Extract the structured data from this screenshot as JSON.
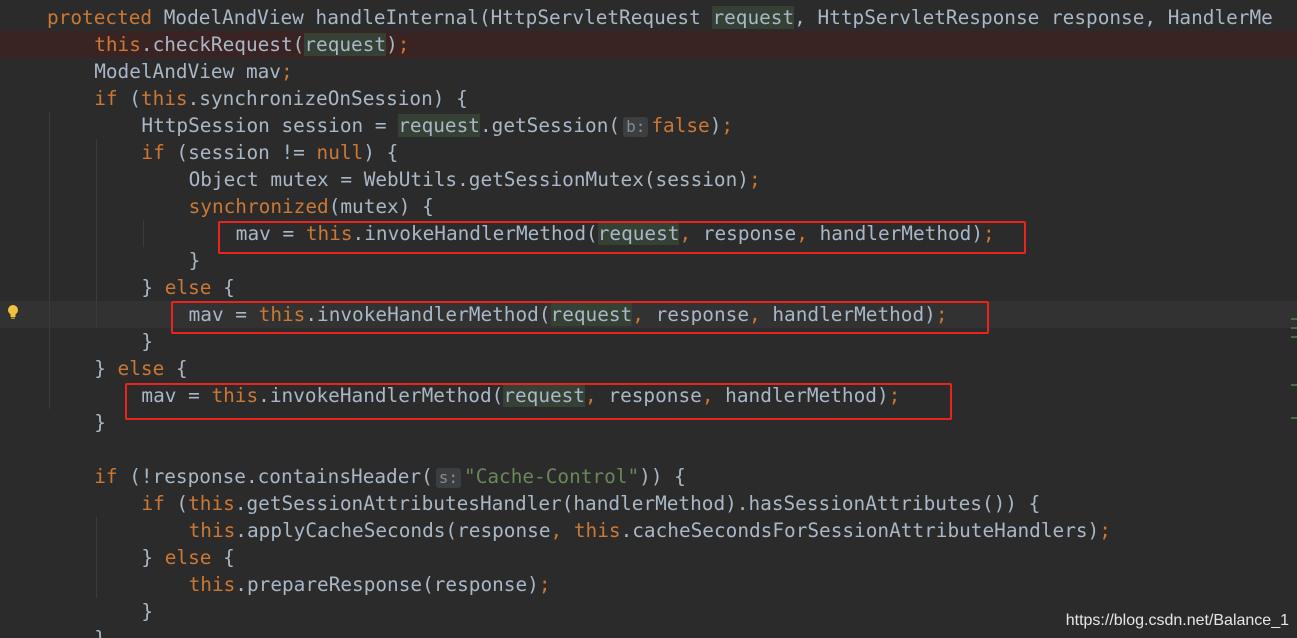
{
  "editor": {
    "theme_colors": {
      "background": "#2b2b2b",
      "keyword": "#cc7832",
      "plain": "#a9b7c6",
      "string": "#6a8759",
      "highlight_box": "#e8251c"
    },
    "lines": [
      {
        "indent": 0,
        "tokens": [
          [
            "kw",
            "protected"
          ],
          [
            "pl",
            " ModelAndView handleInternal(HttpServletRequest "
          ],
          [
            "rq",
            "request"
          ],
          [
            "pl",
            ", HttpServletResponse response, HandlerMe"
          ]
        ]
      },
      {
        "indent": 1,
        "tokens": [
          [
            "kw",
            "this"
          ],
          [
            "pl",
            ".checkRequest("
          ],
          [
            "rq",
            "request"
          ],
          [
            "pl",
            ")"
          ],
          [
            "kw",
            ";"
          ]
        ]
      },
      {
        "indent": 1,
        "tokens": [
          [
            "pl",
            "ModelAndView mav"
          ],
          [
            "kw",
            ";"
          ]
        ]
      },
      {
        "indent": 1,
        "tokens": [
          [
            "kw",
            "if"
          ],
          [
            "pl",
            " ("
          ],
          [
            "kw",
            "this"
          ],
          [
            "pl",
            ".synchronizeOnSession) {"
          ]
        ]
      },
      {
        "indent": 2,
        "tokens": [
          [
            "pl",
            "HttpSession session = "
          ],
          [
            "rq",
            "request"
          ],
          [
            "pl",
            ".getSession("
          ],
          [
            "hint",
            "b:"
          ],
          [
            "kw",
            "false"
          ],
          [
            "pl",
            ")"
          ],
          [
            "kw",
            ";"
          ]
        ]
      },
      {
        "indent": 2,
        "tokens": [
          [
            "kw",
            "if"
          ],
          [
            "pl",
            " (session != "
          ],
          [
            "kw",
            "null"
          ],
          [
            "pl",
            ") {"
          ]
        ]
      },
      {
        "indent": 3,
        "tokens": [
          [
            "pl",
            "Object mutex = WebUtils.getSessionMutex(session)"
          ],
          [
            "kw",
            ";"
          ]
        ]
      },
      {
        "indent": 3,
        "tokens": [
          [
            "kw",
            "synchronized"
          ],
          [
            "pl",
            "(mutex) {"
          ]
        ]
      },
      {
        "indent": 4,
        "tokens": [
          [
            "pl",
            "mav = "
          ],
          [
            "kw",
            "this"
          ],
          [
            "pl",
            ".invokeHandlerMethod("
          ],
          [
            "rq",
            "request"
          ],
          [
            "kw",
            ","
          ],
          [
            "pl",
            " response"
          ],
          [
            "kw",
            ","
          ],
          [
            "pl",
            " handlerMethod)"
          ],
          [
            "kw",
            ";"
          ]
        ]
      },
      {
        "indent": 3,
        "tokens": [
          [
            "pl",
            "}"
          ]
        ]
      },
      {
        "indent": 2,
        "tokens": [
          [
            "pl",
            "} "
          ],
          [
            "kw",
            "else"
          ],
          [
            "pl",
            " {"
          ]
        ]
      },
      {
        "indent": 3,
        "tokens": [
          [
            "pl",
            "mav = "
          ],
          [
            "kw",
            "this"
          ],
          [
            "pl",
            ".invokeHandlerMethod("
          ],
          [
            "rq",
            "request"
          ],
          [
            "kw",
            ","
          ],
          [
            "pl",
            " response"
          ],
          [
            "kw",
            ","
          ],
          [
            "pl",
            " handlerMethod)"
          ],
          [
            "kw",
            ";"
          ]
        ]
      },
      {
        "indent": 2,
        "tokens": [
          [
            "pl",
            "}"
          ]
        ]
      },
      {
        "indent": 1,
        "tokens": [
          [
            "pl",
            "} "
          ],
          [
            "kw",
            "else"
          ],
          [
            "pl",
            " {"
          ]
        ]
      },
      {
        "indent": 2,
        "tokens": [
          [
            "pl",
            "mav = "
          ],
          [
            "kw",
            "this"
          ],
          [
            "pl",
            ".invokeHandlerMethod("
          ],
          [
            "rq",
            "request"
          ],
          [
            "kw",
            ","
          ],
          [
            "pl",
            " response"
          ],
          [
            "kw",
            ","
          ],
          [
            "pl",
            " handlerMethod)"
          ],
          [
            "kw",
            ";"
          ]
        ]
      },
      {
        "indent": 1,
        "tokens": [
          [
            "pl",
            "}"
          ]
        ]
      },
      {
        "indent": 0,
        "tokens": []
      },
      {
        "indent": 1,
        "tokens": [
          [
            "kw",
            "if"
          ],
          [
            "pl",
            " (!response.containsHeader("
          ],
          [
            "hint",
            "s:"
          ],
          [
            "str",
            "\"Cache-Control\""
          ],
          [
            "pl",
            ")) {"
          ]
        ]
      },
      {
        "indent": 2,
        "tokens": [
          [
            "kw",
            "if"
          ],
          [
            "pl",
            " ("
          ],
          [
            "kw",
            "this"
          ],
          [
            "pl",
            ".getSessionAttributesHandler(handlerMethod).hasSessionAttributes()) {"
          ]
        ]
      },
      {
        "indent": 3,
        "tokens": [
          [
            "kw",
            "this"
          ],
          [
            "pl",
            ".applyCacheSeconds(response"
          ],
          [
            "kw",
            ","
          ],
          [
            "pl",
            " "
          ],
          [
            "kw",
            "this"
          ],
          [
            "pl",
            ".cacheSecondsForSessionAttributeHandlers)"
          ],
          [
            "kw",
            ";"
          ]
        ]
      },
      {
        "indent": 2,
        "tokens": [
          [
            "pl",
            "} "
          ],
          [
            "kw",
            "else"
          ],
          [
            "pl",
            " {"
          ]
        ]
      },
      {
        "indent": 3,
        "tokens": [
          [
            "kw",
            "this"
          ],
          [
            "pl",
            ".prepareResponse(response)"
          ],
          [
            "kw",
            ";"
          ]
        ]
      },
      {
        "indent": 2,
        "tokens": [
          [
            "pl",
            "}"
          ]
        ]
      },
      {
        "indent": 1,
        "tokens": [
          [
            "pl",
            "}"
          ]
        ]
      }
    ]
  },
  "watermark": "https://blog.csdn.net/Balance_1"
}
